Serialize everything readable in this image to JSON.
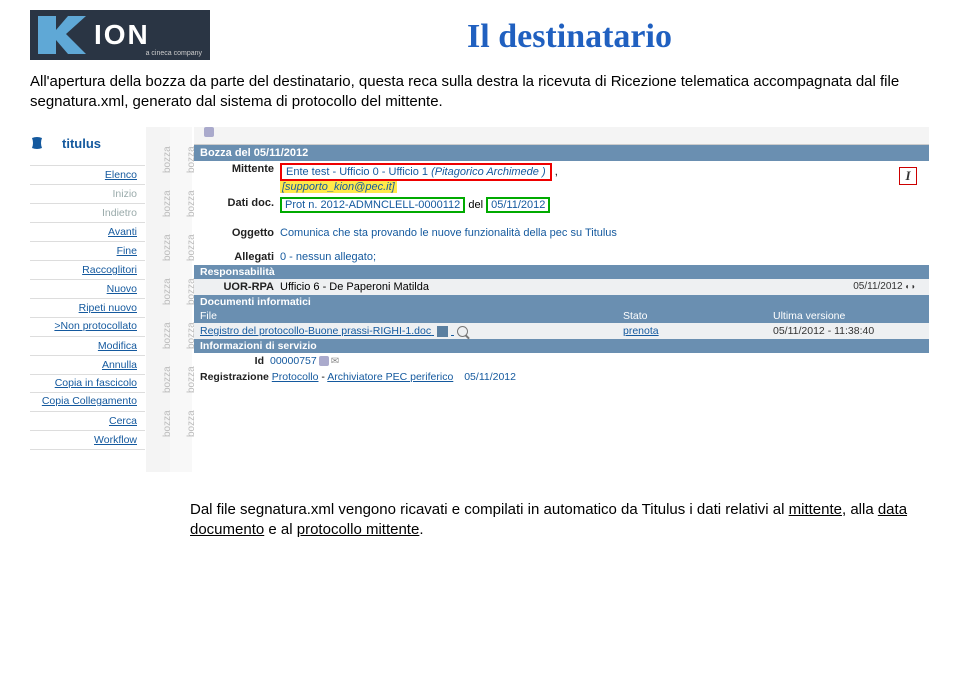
{
  "logo": {
    "text": "ION",
    "sub": "a cineca company"
  },
  "title": "Il destinatario",
  "intro": "All'apertura della bozza da parte del destinatario, questa reca sulla destra la ricevuta di Ricezione telematica accompagnata dal file segnatura.xml, generato dal sistema di protocollo del mittente.",
  "sidebar": {
    "brand": "titulus",
    "items": [
      "Elenco",
      "Inizio",
      "Indietro",
      "Avanti",
      "Fine",
      "Raccoglitori",
      "Nuovo",
      "Ripeti nuovo",
      ">Non protocollato",
      "Modifica",
      "Annulla",
      "Copia in fascicolo",
      "Copia Collegamento",
      "Cerca",
      "Workflow"
    ]
  },
  "bozza_vert": "bozza",
  "main": {
    "header": "Bozza del 05/11/2012",
    "mittente_lbl": "Mittente",
    "mittente_val": "Ente test - Ufficio 0 - Ufficio 1",
    "mittente_paren": "(Pitagorico Archimede )",
    "mittente_sub": "[supporto_kion@pec.it]",
    "dati_lbl": "Dati doc.",
    "dati_prot": "Prot n. 2012-ADMNCLELL-0000112",
    "dati_del": "del",
    "dati_date": "05/11/2012",
    "i_badge": "I",
    "oggetto_lbl": "Oggetto",
    "oggetto_val": "Comunica che sta provando le nuove funzionalità della pec su Titulus",
    "allegati_lbl": "Allegati",
    "allegati_val": "0 - nessun allegato;",
    "resp_hdr": "Responsabilità",
    "uor_lbl": "UOR-RPA",
    "uor_val": "Ufficio 6 - De Paperoni Matilda",
    "uor_date": "05/11/2012",
    "doc_hdr": "Documenti informatici",
    "col_file": "File",
    "col_stato": "Stato",
    "col_ver": "Ultima versione",
    "file_name": "Registro del protocollo-Buone prassi-RIGHI-1.doc",
    "file_stato": "prenota",
    "file_ver": "05/11/2012 - 11:38:40",
    "info_hdr": "Informazioni di servizio",
    "id_lbl": "Id",
    "id_val": "00000757",
    "reg_lbl": "Registrazione",
    "reg_link": "Protocollo",
    "reg_sep": " - ",
    "reg_arch": "Archiviatore PEC periferico",
    "reg_date": "05/11/2012"
  },
  "footer_pre": "Dal file segnatura.xml vengono ricavati e compilati in automatico da Titulus i dati relativi al ",
  "footer_u1": "mittente",
  "footer_mid": ", alla ",
  "footer_u2": "data documento",
  "footer_mid2": " e al ",
  "footer_u3": "protocollo mittente",
  "footer_end": "."
}
